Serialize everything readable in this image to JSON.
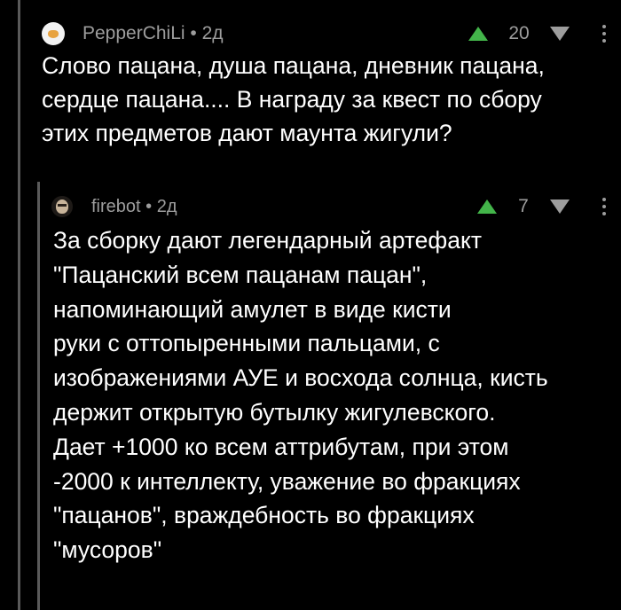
{
  "comments": [
    {
      "author": "PepperChiLi",
      "time": "2д",
      "score": "20",
      "avatar_icon": "pepper-avatar-icon",
      "text": "Слово пацана, душа пацана, дневник пацана,\nсердце пацана.... В награду за квест по сбору\nэтих предметов дают маунта жигули?"
    },
    {
      "author": "firebot",
      "time": "2д",
      "score": "7",
      "avatar_icon": "firebot-avatar-icon",
      "text": "За сборку дают легендарный артефакт\n\"Пацанский всем пацанам пацан\",\nнапоминающий амулет в виде кисти\nруки с оттопыренными пальцами, с\nизображениями АУЕ и восхода солнца, кисть\nдержит открытую бутылку жигулевского.\nДает +1000 ко всем аттрибутам, при этом\n-2000 к интеллекту, уважение во фракциях\n\"пацанов\", враждебность во фракциях\n\"мусоров\""
    }
  ],
  "meta_separator": " • ",
  "colors": {
    "background": "#000000",
    "text": "#ffffff",
    "muted": "#9d9d9d",
    "upvote": "#43b54a",
    "thread_line": "#5a5a5a"
  },
  "icons": {
    "upvote": "arrow-up-icon",
    "downvote": "arrow-down-icon",
    "more": "more-vertical-icon"
  }
}
